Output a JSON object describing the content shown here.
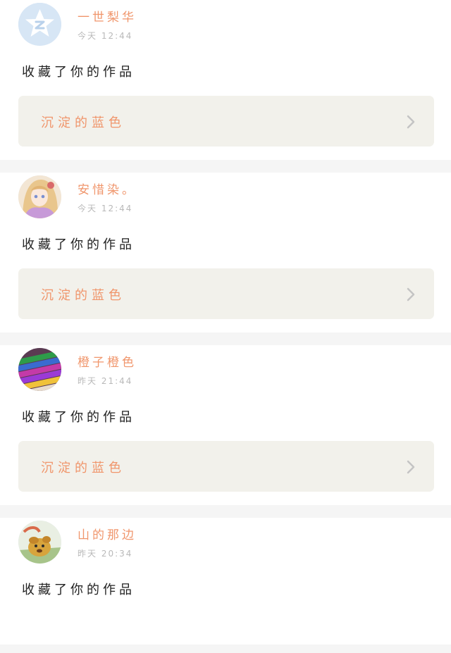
{
  "colors": {
    "accent": "#f0966c",
    "text": "#222222",
    "muted": "#b9b9b9",
    "card_bg": "#ffffff",
    "work_bg": "#f2f1eb",
    "separator": "#f5f5f5"
  },
  "feed": [
    {
      "avatar_icon": "qq-star-icon",
      "username": "一世梨华",
      "time": "今天 12:44",
      "action": "收藏了你的作品",
      "work": {
        "title": "沉淀的蓝色",
        "chevron_icon": "chevron-right-icon"
      }
    },
    {
      "avatar_icon": "anime-girl-avatar",
      "username": "安惜染。",
      "time": "今天 12:44",
      "action": "收藏了你的作品",
      "work": {
        "title": "沉淀的蓝色",
        "chevron_icon": "chevron-right-icon"
      }
    },
    {
      "avatar_icon": "colored-pencils-avatar",
      "username": "橙子橙色",
      "time": "昨天 21:44",
      "action": "收藏了你的作品",
      "work": {
        "title": "沉淀的蓝色",
        "chevron_icon": "chevron-right-icon"
      }
    },
    {
      "avatar_icon": "cartoon-dog-avatar",
      "username": "山的那边",
      "time": "昨天 20:34",
      "action": "收藏了你的作品"
    }
  ]
}
